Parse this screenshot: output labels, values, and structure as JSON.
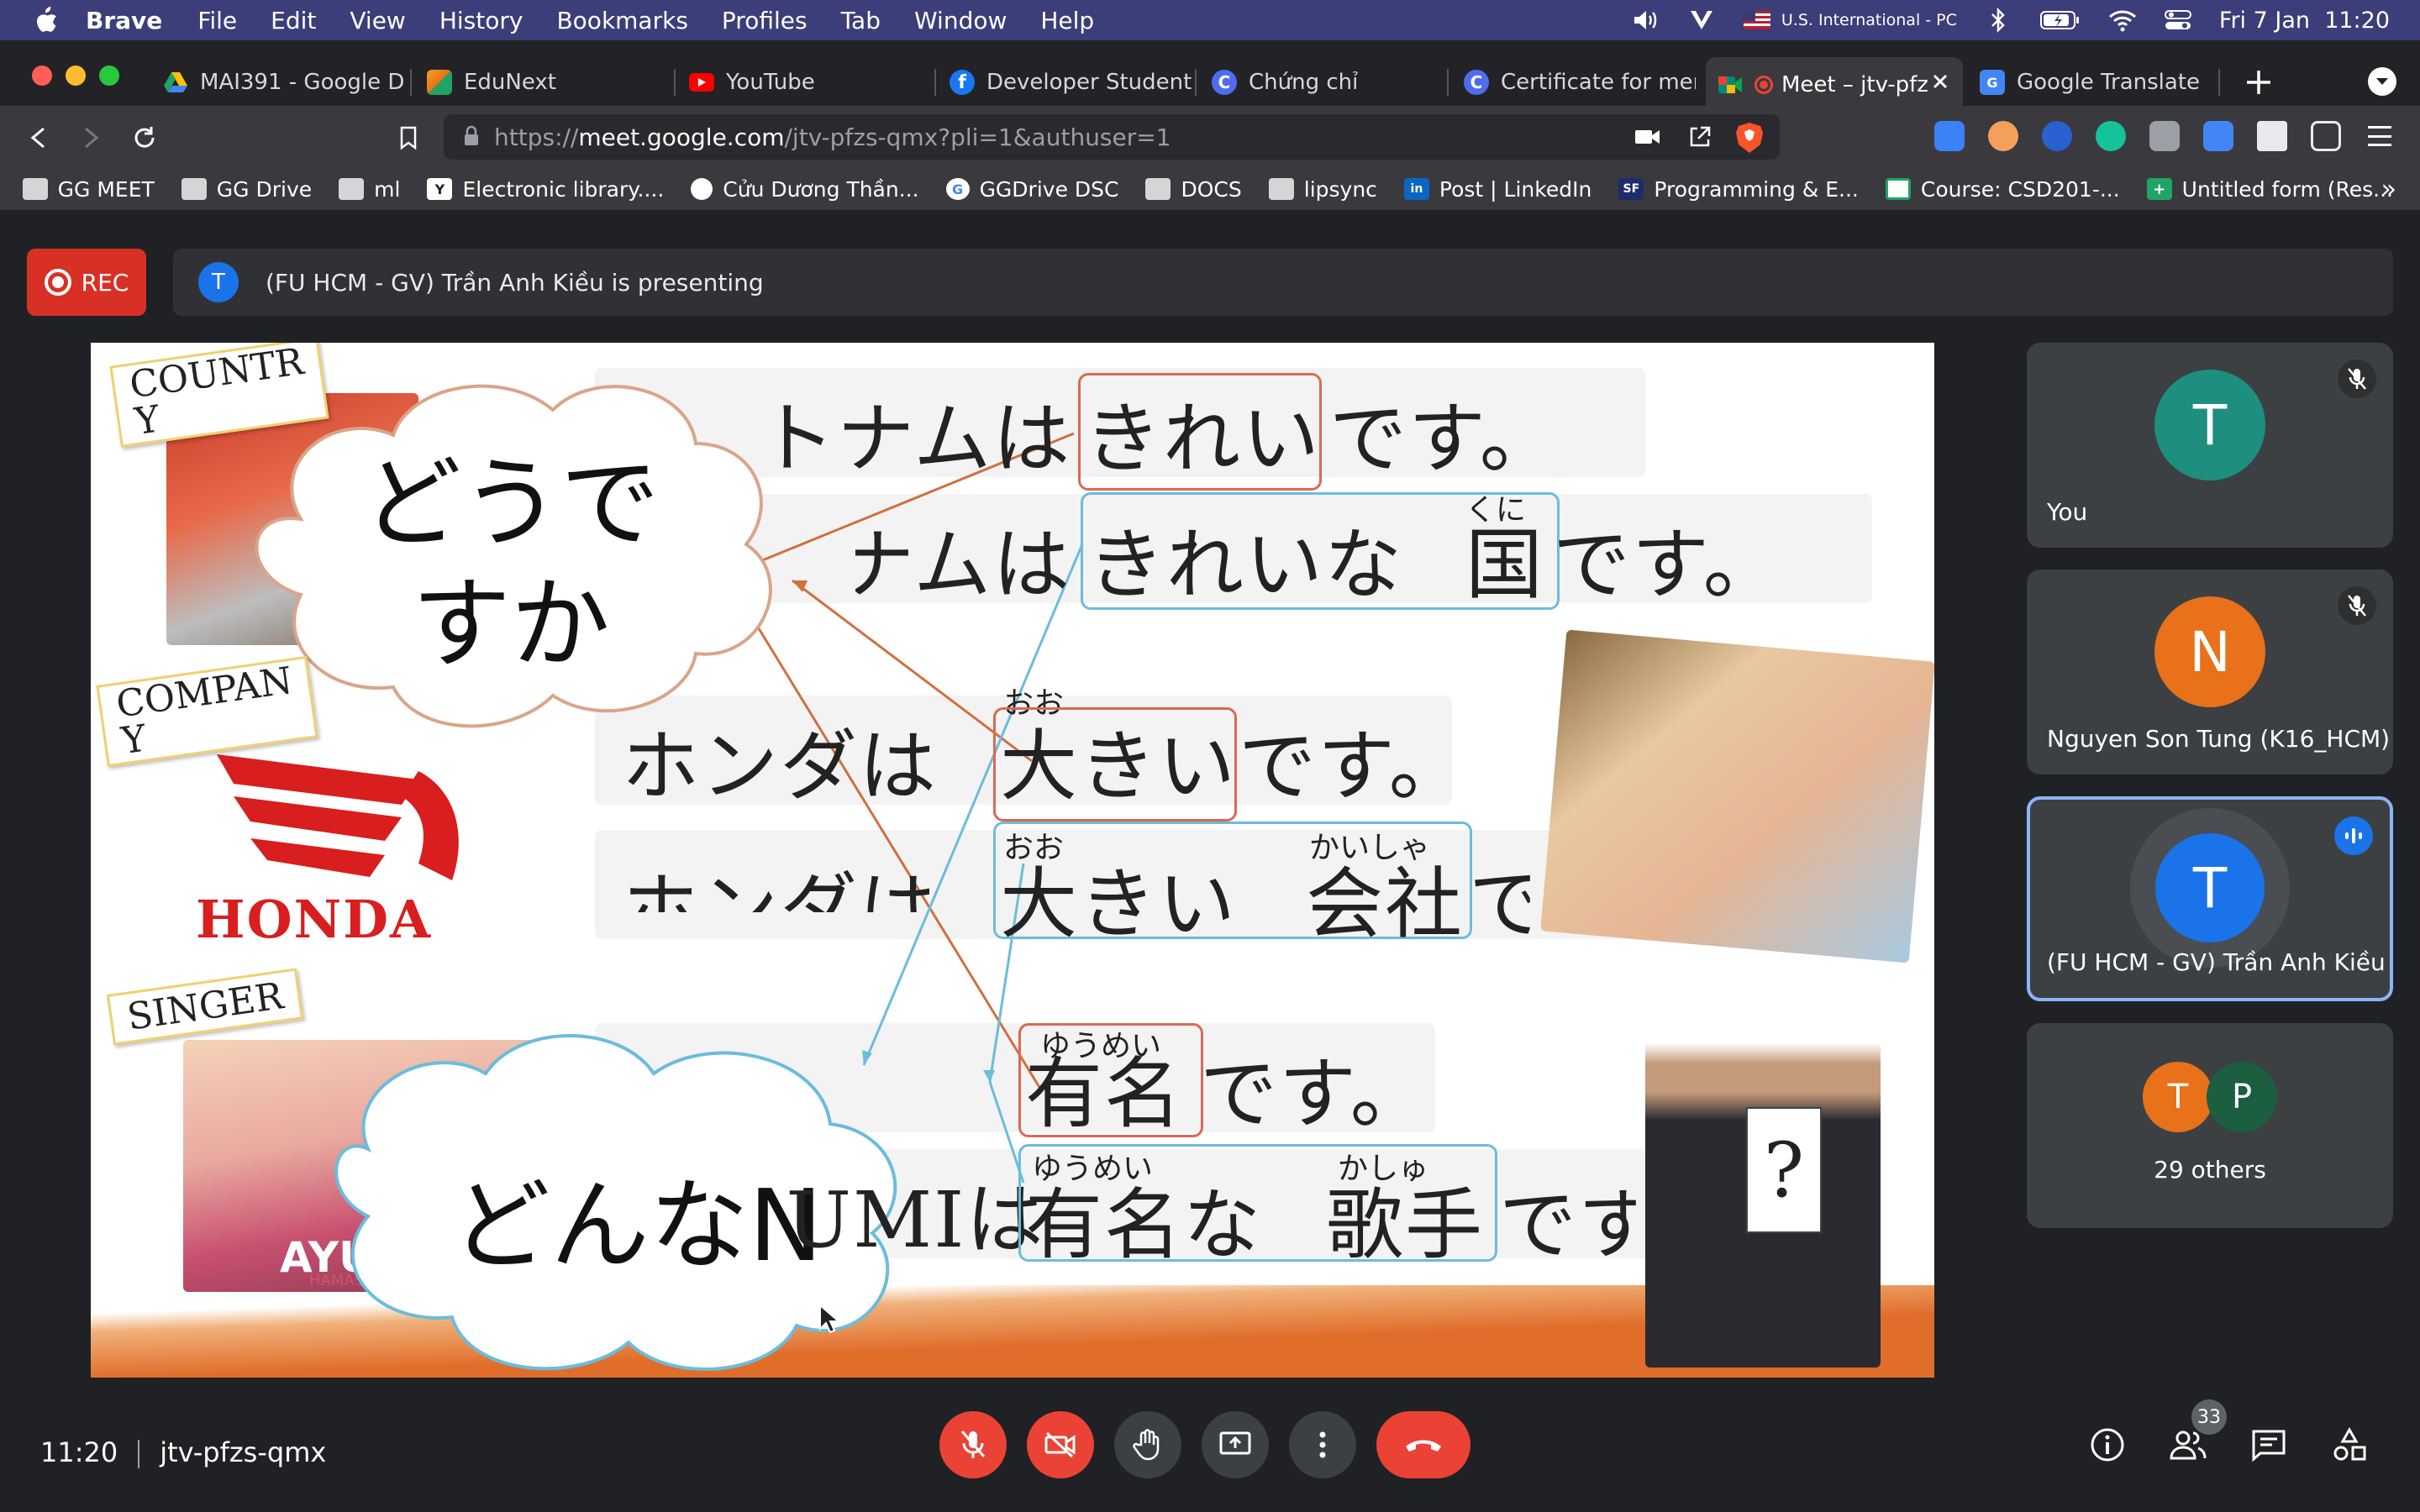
{
  "menubar": {
    "app_name": "Brave",
    "items": [
      "File",
      "Edit",
      "View",
      "History",
      "Bookmarks",
      "Profiles",
      "Tab",
      "Window",
      "Help"
    ],
    "input_source": "U.S. International - PC",
    "datetime": "Fri 7 Jan  11:20"
  },
  "tabs": [
    {
      "title": "MAI391 - Google Dri",
      "color": "#1fa463"
    },
    {
      "title": "EduNext",
      "color": "#e8711a"
    },
    {
      "title": "YouTube",
      "color": "#ff0000"
    },
    {
      "title": "Developer Student C",
      "color": "#1877f2"
    },
    {
      "title": "Chứng chỉ",
      "color": "#4f6cf0"
    },
    {
      "title": "Certificate for memb",
      "color": "#4f6cf0"
    },
    {
      "title": "Meet – jtv-pfz",
      "color": "#00897b"
    },
    {
      "title": "Google Translate",
      "color": "#4285f4"
    }
  ],
  "address": {
    "prefix": "https://",
    "domain": "meet.google.com",
    "path": "/jtv-pfzs-qmx?pli=1&authuser=1"
  },
  "bookmarks": [
    {
      "label": "GG MEET"
    },
    {
      "label": "GG Drive"
    },
    {
      "label": "ml"
    },
    {
      "label": "Electronic library...."
    },
    {
      "label": "Cửu Dương Thần..."
    },
    {
      "label": "GGDrive DSC"
    },
    {
      "label": "DOCS"
    },
    {
      "label": "lipsync"
    },
    {
      "label": "Post | LinkedIn"
    },
    {
      "label": "Programming & E..."
    },
    {
      "label": "Course: CSD201-..."
    },
    {
      "label": "Untitled form (Res..."
    }
  ],
  "meet": {
    "rec_label": "REC",
    "presenter_initial": "T",
    "presenting_text": "(FU HCM - GV) Trần Anh Kiều is presenting",
    "time": "11:20",
    "meeting_code": "jtv-pfzs-qmx",
    "people_count": "33"
  },
  "slide": {
    "labels": [
      "COUNTR\nY",
      "COMPAN\nY",
      "SINGER"
    ],
    "cloud1": "どうで\nすか",
    "cloud2": "どんなN",
    "lines": [
      {
        "a": "ベトナムは",
        "b": "きれい",
        "c": "です。"
      },
      {
        "a": "ベトナムは",
        "b": "きれいな",
        "ruby": "くに",
        "d": "国",
        "c": "です。"
      },
      {
        "a": "ホンダは",
        "ruby": "おお",
        "b": "大きい",
        "c": "です。"
      },
      {
        "a": "ホンダは",
        "ruby": "おお",
        "b": "大きい",
        "ruby2": "かいしゃ",
        "d": "会社",
        "c": "です。"
      },
      {
        "a": "AYUMIは",
        "ruby": "ゆうめい",
        "b": "有名",
        "c": "です。"
      },
      {
        "a": "AYUMIは",
        "ruby": "ゆうめい",
        "b": "有名な",
        "ruby2": "かしゅ",
        "d": "歌手",
        "c": "です。"
      }
    ],
    "ayumi": "AYUMI",
    "ayumi_sub": "HAMASAKI",
    "honda": "HONDA"
  },
  "participants": [
    {
      "initial": "T",
      "name": "You",
      "color": "#1e8e7e"
    },
    {
      "initial": "N",
      "name": "Nguyen Son Tung (K16_HCM)",
      "color": "#e8711a"
    },
    {
      "initial": "T",
      "name": "(FU HCM - GV) Trần Anh Kiều",
      "color": "#1a73e8"
    },
    {
      "initial1": "T",
      "initial2": "P",
      "name": "29 others",
      "color1": "#e8711a",
      "color2": "#1b5e40"
    }
  ]
}
